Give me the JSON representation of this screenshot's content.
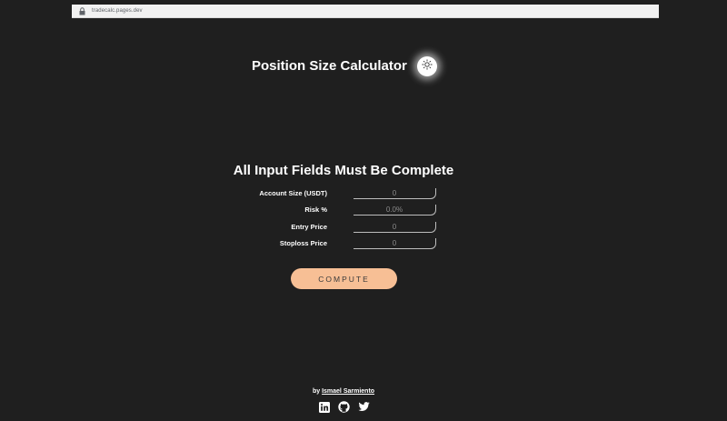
{
  "browser": {
    "url": "tradecalc.pages.dev"
  },
  "header": {
    "title": "Position Size Calculator",
    "theme_toggle_icon": "sun-icon"
  },
  "form": {
    "heading": "All Input Fields Must Be Complete",
    "fields": [
      {
        "label": "Account Size (USDT)",
        "placeholder": "0"
      },
      {
        "label": "Risk %",
        "placeholder": "0.0%"
      },
      {
        "label": "Entry Price",
        "placeholder": "0"
      },
      {
        "label": "Stoploss Price",
        "placeholder": "0"
      }
    ],
    "compute_label": "COMPUTE"
  },
  "footer": {
    "by_prefix": "by",
    "author": "Ismael Sarmiento",
    "social_icons": [
      "linkedin-icon",
      "github-icon",
      "twitter-icon"
    ]
  },
  "colors": {
    "background": "#1f1f1f",
    "accent_button": "#f7bf95",
    "text": "#ffffff"
  }
}
